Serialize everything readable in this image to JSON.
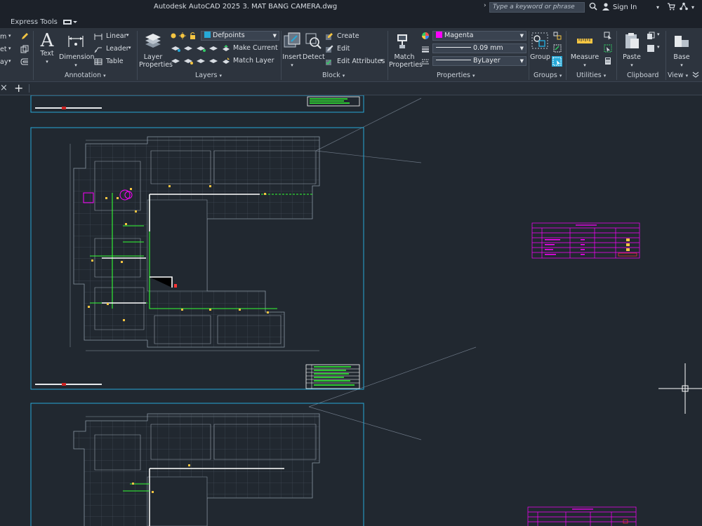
{
  "app": {
    "title": "Autodesk AutoCAD 2025    3. MAT BANG CAMERA.dwg",
    "search_placeholder": "Type a keyword or phrase",
    "sign_in": "Sign In"
  },
  "tabs": {
    "express_tools": "Express Tools"
  },
  "ribbon": {
    "annotation": {
      "title": "Annotation",
      "text": "Text",
      "dimension": "Dimension",
      "linear": "Linear",
      "leader": "Leader",
      "table": "Table",
      "cut_left_1": "m",
      "cut_left_2": "et",
      "cut_left_3": "ay"
    },
    "layers": {
      "title": "Layers",
      "layer_properties": "Layer Properties",
      "current_layer": "Defpoints",
      "make_current": "Make Current",
      "match_layer": "Match Layer"
    },
    "block": {
      "title": "Block",
      "insert": "Insert",
      "detect": "Detect",
      "create": "Create",
      "edit": "Edit",
      "edit_attributes": "Edit Attributes"
    },
    "properties": {
      "title": "Properties",
      "match_properties": "Match Properties",
      "color": "Magenta",
      "lineweight": "0.09 mm",
      "linetype": "ByLayer"
    },
    "groups": {
      "title": "Groups",
      "group": "Group"
    },
    "utilities": {
      "title": "Utilities",
      "measure": "Measure"
    },
    "clipboard": {
      "title": "Clipboard",
      "paste": "Paste"
    },
    "view": {
      "title": "View",
      "base": "Base"
    }
  },
  "colors": {
    "accent_magenta": "#ff00ff",
    "frame_cyan": "#26a9d8",
    "cad_green": "#33ff33",
    "background": "#212830"
  }
}
